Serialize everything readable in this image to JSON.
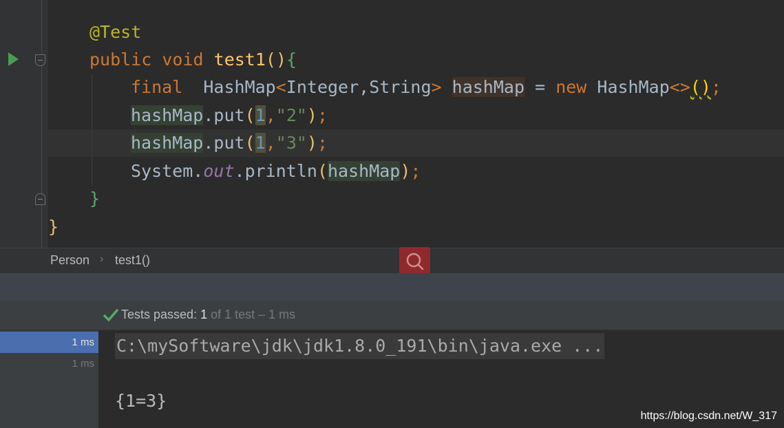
{
  "editor": {
    "lines": {
      "annotation": "@Test",
      "method_kw1": "public",
      "method_kw2": "void",
      "method_name": "test1",
      "method_parens": "()",
      "method_brace": "{",
      "decl_final": "final",
      "decl_type": "HashMap",
      "decl_generic_open": "<",
      "decl_generic_args": "Integer,String",
      "decl_generic_close": ">",
      "decl_var": "hashMap",
      "decl_eq": "=",
      "decl_new": "new",
      "decl_ctor": "HashMap",
      "decl_diamond": "<>",
      "decl_parens": "()",
      "decl_semi": ";",
      "put1_var": "hashMap",
      "put1_call": ".put",
      "put1_key": "1",
      "put1_val": "\"2\"",
      "put2_var": "hashMap",
      "put2_call": ".put",
      "put2_key": "1",
      "put2_val": "\"3\"",
      "print_sys": "System.",
      "print_out": "out",
      "print_call": ".println",
      "print_arg": "hashMap",
      "close_method": "}",
      "close_class": "}"
    }
  },
  "breadcrumb": {
    "class_name": "Person",
    "separator": "›",
    "method_name": "test1()"
  },
  "run": {
    "status_prefix": "Tests passed: ",
    "status_count": "1",
    "status_rest": " of 1 test – 1 ms",
    "tree": [
      "1 ms",
      "1 ms"
    ],
    "console": {
      "command": "C:\\mySoftware\\jdk\\jdk1.8.0_191\\bin\\java.exe ...",
      "output": "{1=3}"
    }
  },
  "watermark": "https://blog.csdn.net/W_317",
  "colors": {
    "keyword": "#cc7832",
    "annotation": "#bbb529",
    "string": "#6a8759",
    "number": "#6897bb",
    "selection": "#4b6eaf",
    "pass": "#59a869"
  },
  "icons": [
    "run-gutter-icon",
    "fold-icon",
    "search-icon",
    "check-icon"
  ]
}
